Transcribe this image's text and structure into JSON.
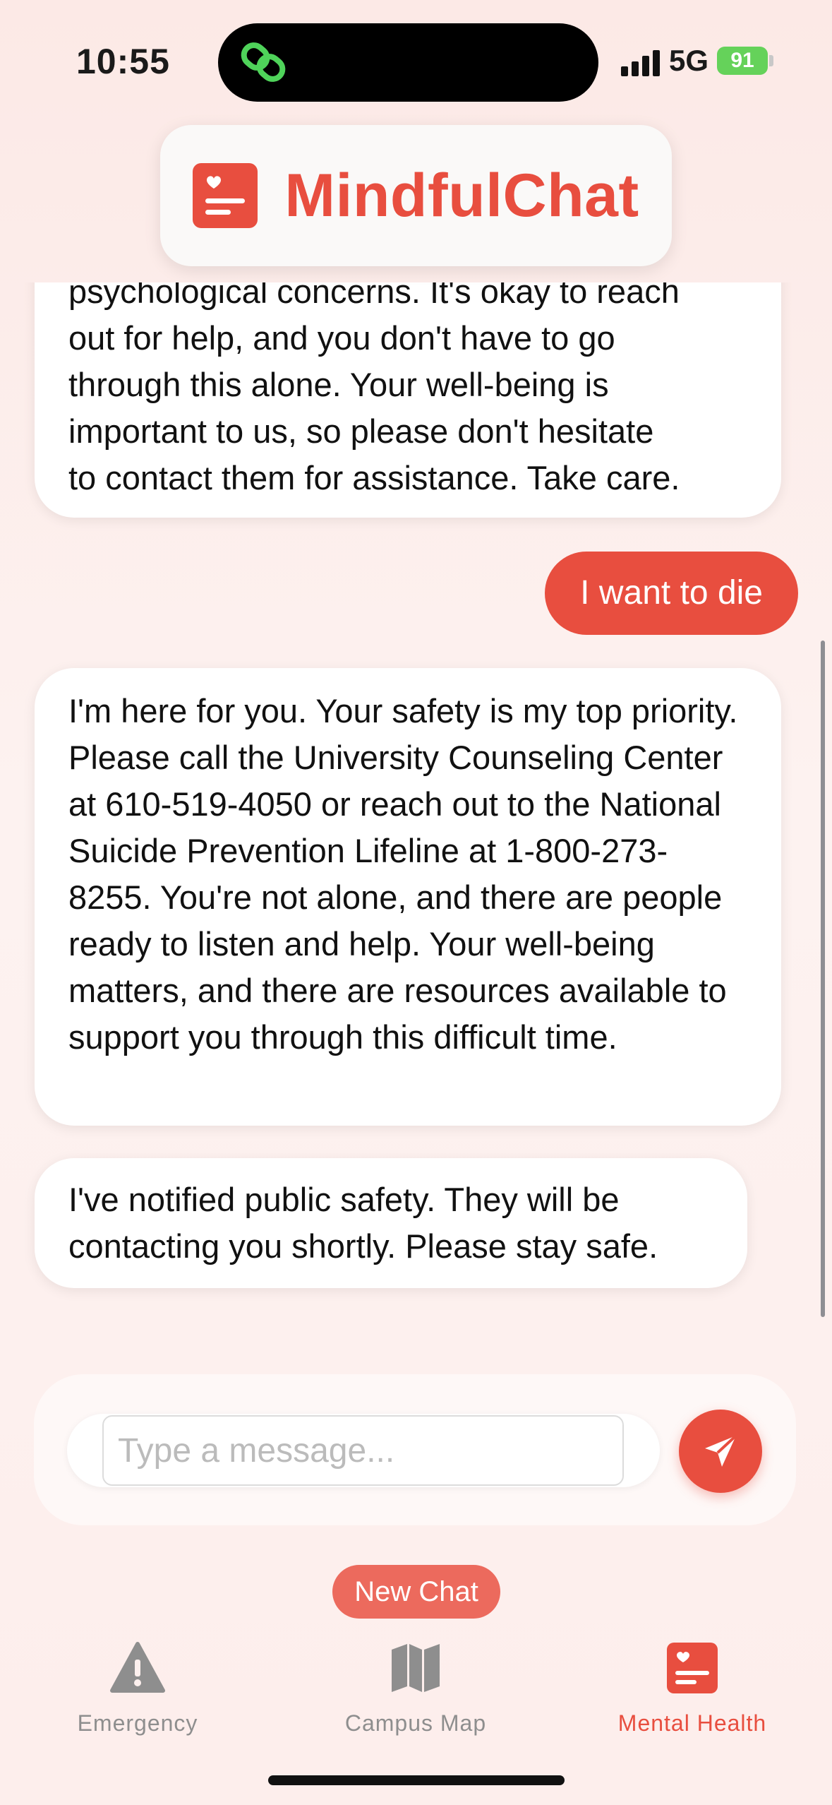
{
  "status_bar": {
    "time": "10:55",
    "network": "5G",
    "battery": "91"
  },
  "header": {
    "title": "MindfulChat"
  },
  "messages": [
    {
      "role": "assistant",
      "lines": [
        "psychological concerns. It's okay to reach",
        "out for help, and you don't have to go",
        "through this alone. Your well-being is",
        "important to us, so please don't hesitate",
        "to contact them for assistance. Take care."
      ]
    },
    {
      "role": "user",
      "text": "I want to die"
    },
    {
      "role": "assistant",
      "text": "I'm here for you. Your safety is my top priority. Please call the University Counseling Center at 610-519-4050 or reach out to the National Suicide Prevention Lifeline at 1-800-273-8255. You're not alone, and there are people ready to listen and help. Your well-being matters, and there are resources available to support you through this difficult time."
    },
    {
      "role": "assistant",
      "text": "I've notified public safety. They will be contacting you shortly. Please stay safe."
    }
  ],
  "composer": {
    "placeholder": "Type a message...",
    "value": ""
  },
  "new_chat_label": "New Chat",
  "tabs": [
    {
      "label": "Emergency",
      "icon": "warning-triangle-icon"
    },
    {
      "label": "Campus Map",
      "icon": "map-icon"
    },
    {
      "label": "Mental Health",
      "icon": "heart-document-icon",
      "active": true
    }
  ],
  "colors": {
    "accent": "#e84e3f",
    "inactive": "#8e8e8e",
    "battery": "#65d25a"
  }
}
